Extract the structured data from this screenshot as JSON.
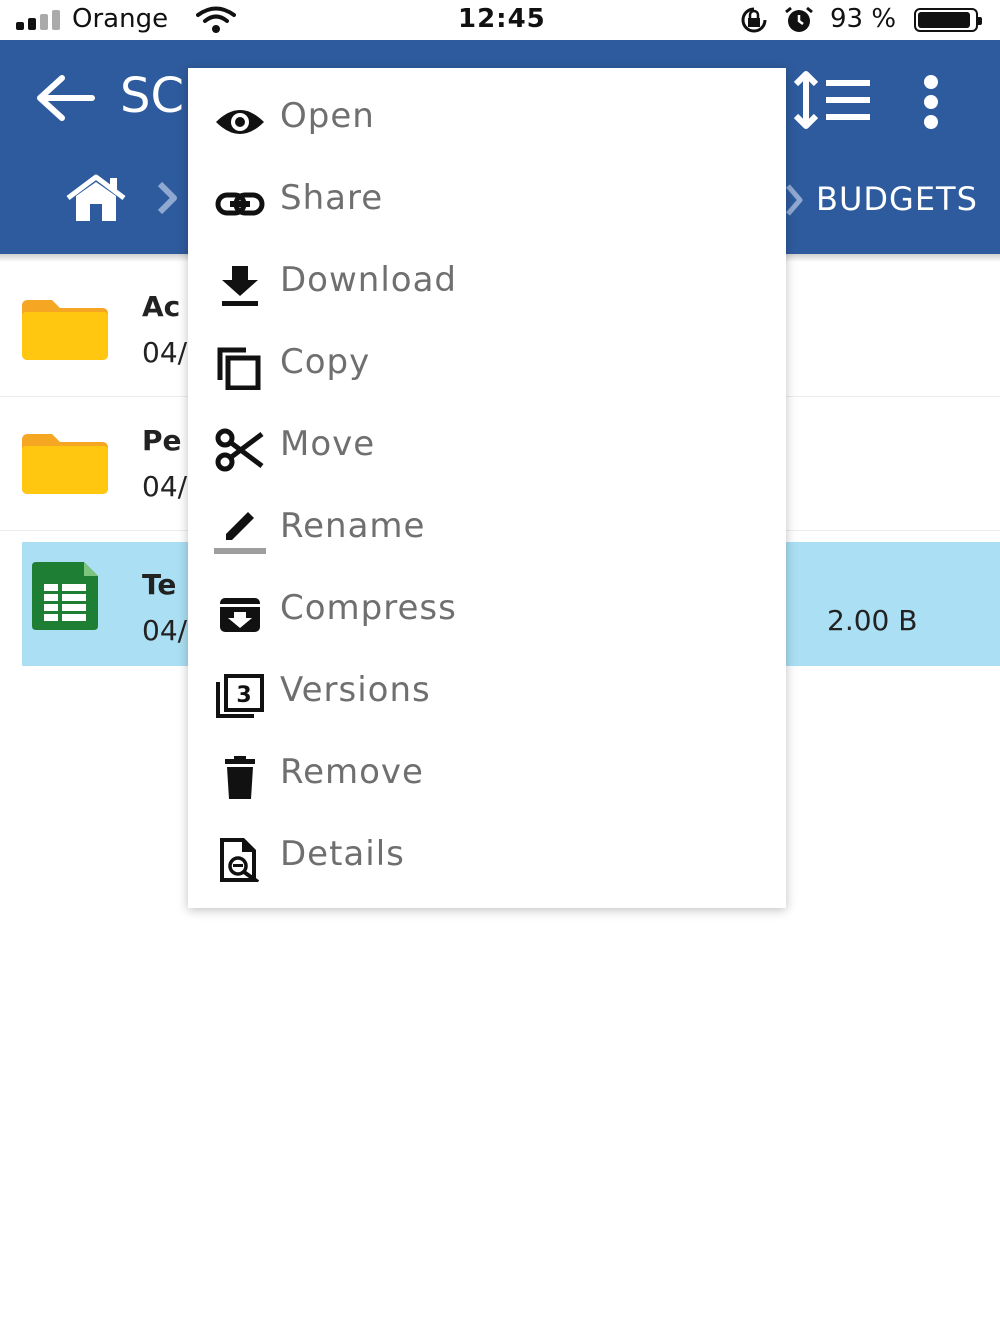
{
  "status_bar": {
    "carrier": "Orange",
    "time": "12:45",
    "battery_pct": "93 %",
    "battery_level": 0.93
  },
  "header": {
    "title": "SC",
    "breadcrumb_current": "BUDGETS"
  },
  "files": [
    {
      "name": "Ac",
      "date": "04/",
      "size": ""
    },
    {
      "name": "Pe",
      "date": "04/",
      "size": ""
    },
    {
      "name": "Te",
      "date": "04/",
      "size": "2.00 B"
    }
  ],
  "menu": {
    "items": [
      {
        "label": "Open",
        "icon": "eye-icon"
      },
      {
        "label": "Share",
        "icon": "link-icon"
      },
      {
        "label": "Download",
        "icon": "download-icon"
      },
      {
        "label": "Copy",
        "icon": "copy-icon"
      },
      {
        "label": "Move",
        "icon": "scissors-icon"
      },
      {
        "label": "Rename",
        "icon": "pencil-icon"
      },
      {
        "label": "Compress",
        "icon": "archive-icon"
      },
      {
        "label": "Versions",
        "icon": "versions-icon"
      },
      {
        "label": "Remove",
        "icon": "trash-icon"
      },
      {
        "label": "Details",
        "icon": "details-icon"
      }
    ]
  },
  "colors": {
    "header": "#2e5b9e",
    "selected_row": "#abdff3",
    "folder": "#ffc107",
    "spreadsheet": "#1e7e34",
    "menu_text": "#6f6f6f"
  }
}
